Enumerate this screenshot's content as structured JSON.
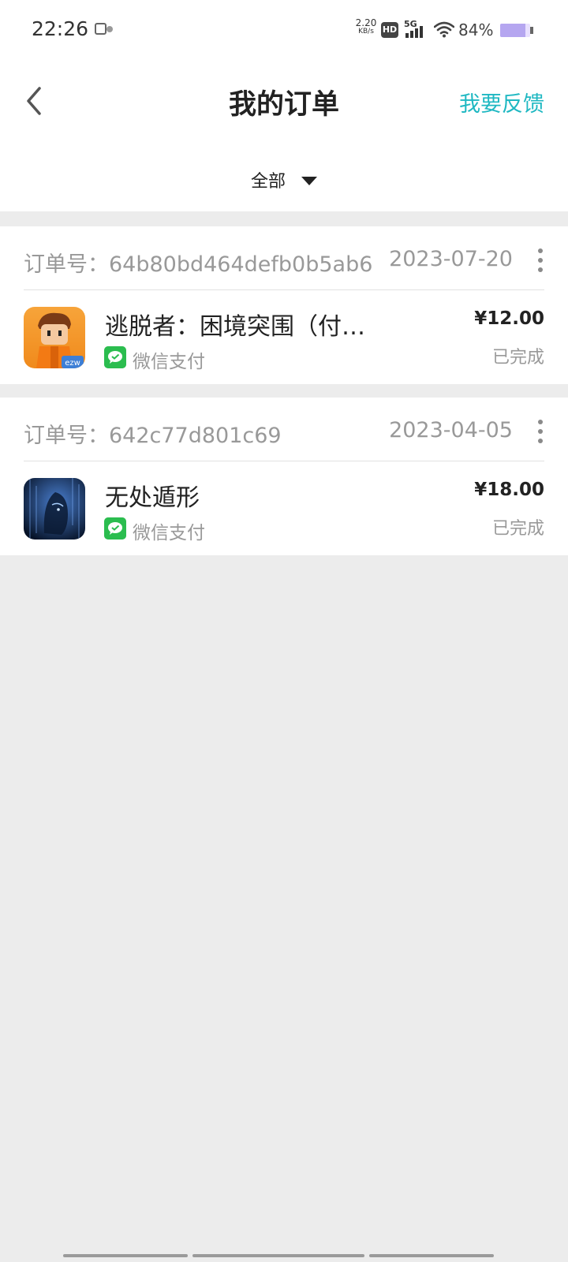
{
  "status_bar": {
    "time": "22:26",
    "net_speed_value": "2.20",
    "net_speed_unit": "KB/s",
    "hd_label": "HD",
    "network_label": "5G",
    "battery_percent": "84%",
    "battery_level": 0.84
  },
  "header": {
    "title": "我的订单",
    "feedback_label": "我要反馈",
    "back_icon": "chevron-left-icon"
  },
  "filter": {
    "selected": "全部"
  },
  "orders": [
    {
      "order_no": "订单号：64b80bd464defb0b5ab6",
      "date": "2023-07-20",
      "game_name": "逃脱者：困境突围（付…",
      "pay_method": "微信支付",
      "price": "¥12.00",
      "status": "已完成"
    },
    {
      "order_no": "订单号：642c77d801c69",
      "date": "2023-04-05",
      "game_name": "无处遁形",
      "pay_method": "微信支付",
      "price": "¥18.00",
      "status": "已完成"
    }
  ],
  "colors": {
    "accent": "#1fb8c2",
    "wechat_green": "#2bbd4f",
    "background": "#ececec"
  }
}
